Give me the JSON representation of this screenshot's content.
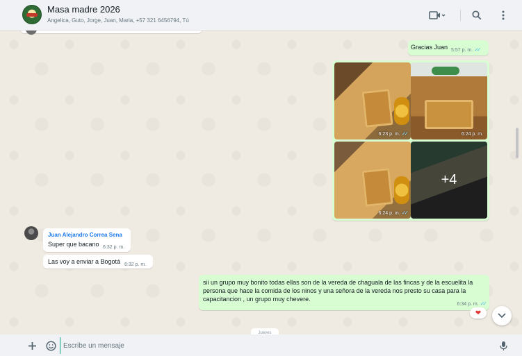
{
  "header": {
    "title": "Masa madre 2026",
    "members": "Angelica, Guto, Jorge, Juan, Maria, +57 321 6456794, Tú"
  },
  "messages": {
    "gracias": {
      "text": "Gracias Juan",
      "time": "5:57 p. m.",
      "ticks": "✓✓"
    },
    "media": {
      "photos": [
        {
          "time": "6:23 p. m.",
          "ticks": "✓✓"
        },
        {
          "time": "6:24 p. m.",
          "ticks": ""
        },
        {
          "time": "6:24 p. m.",
          "ticks": "✓✓"
        }
      ],
      "more_count": "+4"
    },
    "incoming_1": {
      "sender": "Juan Alejandro Correa Sena",
      "text": "Super que bacano",
      "time": "6:32 p. m."
    },
    "incoming_2": {
      "text": "Las voy a enviar a Bogotá",
      "time": "6:32 p. m."
    },
    "outgoing_long": {
      "text": "sii un grupo muy bonito todas ellas son de la vereda de chaguala de las fincas y de la escuelita la persona que hace la comida de los ninos y una  señora de la vereda nos presto su casa para la capacitancion , un grupo muy chevere.",
      "time": "6:34 p. m.",
      "ticks": "✓✓",
      "reaction": "❤"
    },
    "date_chip": "Jueves"
  },
  "composer": {
    "placeholder": "Escribe un mensaje"
  },
  "colors": {
    "outgoing_bubble": "#d9fdd3",
    "incoming_bubble": "#ffffff",
    "sender_name": "#1f7aec",
    "read_ticks": "#53bdeb"
  },
  "icons": [
    "group-avatar",
    "video-call-icon",
    "search-icon",
    "menu-icon",
    "chevron-down-icon",
    "plus-icon",
    "sticker-icon",
    "mic-icon",
    "heart-icon"
  ]
}
